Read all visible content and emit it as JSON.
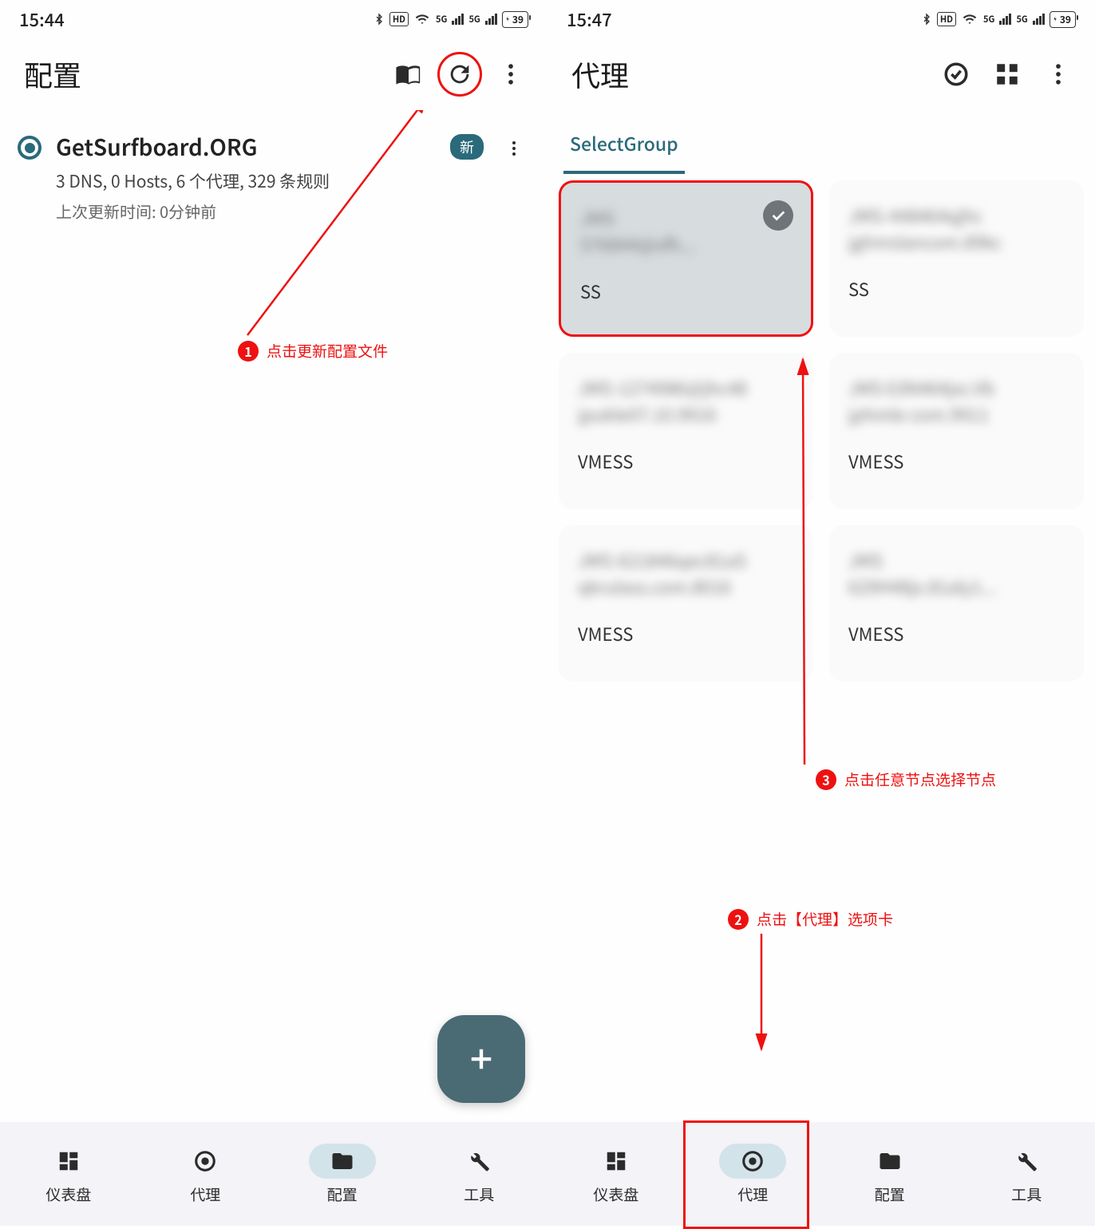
{
  "left": {
    "status_time": "15:44",
    "battery": "39",
    "title": "配置",
    "config": {
      "name": "GetSurfboard.ORG",
      "badge": "新",
      "detail": "3 DNS, 0 Hosts, 6 个代理, 329 条规则",
      "updated": "上次更新时间: 0分钟前"
    },
    "nav": {
      "dashboard": "仪表盘",
      "proxy": "代理",
      "config": "配置",
      "tools": "工具"
    },
    "annot1": "点击更新配置文件"
  },
  "right": {
    "status_time": "15:47",
    "battery": "39",
    "title": "代理",
    "tab": "SelectGroup",
    "cards": [
      {
        "line1": "JMS",
        "line2": "576844@xfh...",
        "proto": "SS",
        "selected": true
      },
      {
        "line1": "JMS-448464qjhc",
        "line2": "jghmslancom.89kc",
        "proto": "SS"
      },
      {
        "line1": "JMS-1274986@jhc48",
        "line2": "jpukle07.10.9916",
        "proto": "VMESS"
      },
      {
        "line1": "JMS 63N464jxc.Vb",
        "line2": "jphmle com.9911",
        "proto": "VMESS"
      },
      {
        "line1": "JMS-621846qec81aS",
        "line2": "qkrulass.com.8016",
        "proto": "VMESS"
      },
      {
        "line1": "JMS",
        "line2": "629H48jx.81aly1...",
        "proto": "VMESS"
      }
    ],
    "nav": {
      "dashboard": "仪表盘",
      "proxy": "代理",
      "config": "配置",
      "tools": "工具"
    },
    "annot2": "点击【代理】选项卡",
    "annot3": "点击任意节点选择节点"
  }
}
